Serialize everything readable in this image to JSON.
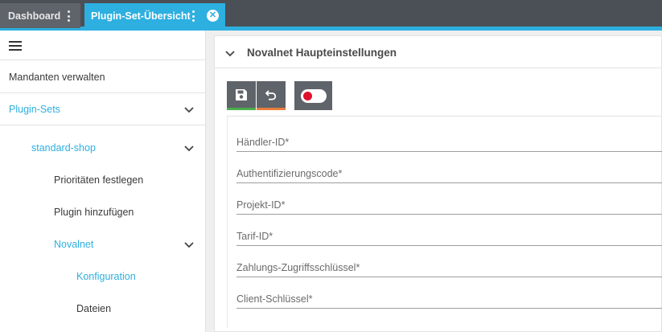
{
  "tabs": [
    {
      "label": "Dashboard",
      "active": false
    },
    {
      "label": "Plugin-Set-Übersicht",
      "active": true
    }
  ],
  "colors": {
    "accent": "#2dafe0",
    "tabbar": "#4b4f56",
    "save": "#4cae4c",
    "undo": "#e87e3c",
    "toggle_dot": "#e0102b"
  },
  "sidebar": {
    "menu_icon": "hamburger-icon",
    "items": [
      {
        "label": "Mandanten verwalten"
      },
      {
        "label": "Plugin-Sets",
        "icon": "chevron-down-icon"
      },
      {
        "label": "standard-shop",
        "icon": "chevron-down-icon"
      },
      {
        "label": "Prioritäten festlegen"
      },
      {
        "label": "Plugin hinzufügen"
      },
      {
        "label": "Novalnet",
        "icon": "chevron-down-icon"
      },
      {
        "label": "Konfiguration"
      },
      {
        "label": "Dateien"
      }
    ]
  },
  "panel": {
    "title": "Novalnet Haupteinstellungen",
    "toolbar": {
      "save_icon": "save-icon",
      "undo_icon": "undo-icon",
      "toggle_icon": "toggle-icon"
    },
    "fields": [
      {
        "placeholder": "Händler-ID*",
        "value": ""
      },
      {
        "placeholder": "Authentifizierungscode*",
        "value": ""
      },
      {
        "placeholder": "Projekt-ID*",
        "value": ""
      },
      {
        "placeholder": "Tarif-ID*",
        "value": ""
      },
      {
        "placeholder": "Zahlungs-Zugriffsschlüssel*",
        "value": ""
      },
      {
        "placeholder": "Client-Schlüssel*",
        "value": ""
      }
    ]
  }
}
